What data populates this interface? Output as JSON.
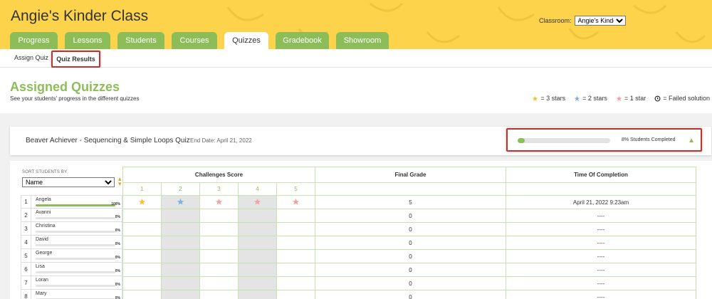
{
  "header": {
    "title": "Angie's Kinder Class",
    "classroom_label": "Classroom:",
    "classroom_value": "Angie's Kinde..."
  },
  "tabs": [
    {
      "label": "Progress",
      "active": false
    },
    {
      "label": "Lessons",
      "active": false
    },
    {
      "label": "Students",
      "active": false
    },
    {
      "label": "Courses",
      "active": false
    },
    {
      "label": "Quizzes",
      "active": true
    },
    {
      "label": "Gradebook",
      "active": false
    },
    {
      "label": "Showroom",
      "active": false
    }
  ],
  "subnav": {
    "assign": "Assign Quiz",
    "results": "Quiz Results"
  },
  "page": {
    "title": "Assigned Quizzes",
    "subtitle": "See your students' progress in the different quizzes"
  },
  "legend": {
    "three_stars": "= 3 stars",
    "two_stars": "= 2 stars",
    "one_star": "= 1 star",
    "failed": "= Failed solution"
  },
  "quiz": {
    "name": "Beaver Achiever - Sequencing & Simple Loops Quiz",
    "end_date": "End Date:  April 21, 2022",
    "progress_text": "8% Students Completed",
    "progress_fraction": 0.08
  },
  "sort": {
    "label": "SORT STUDENTS BY",
    "value": "Name"
  },
  "table": {
    "challenges_header": "Challenges Score",
    "final_header": "Final Grade",
    "time_header": "Time Of Completion",
    "challenge_numbers": [
      "1",
      "2",
      "3",
      "4",
      "5"
    ]
  },
  "colors": {
    "gold": "#f6c338",
    "blue": "#7ab5dc",
    "pink": "#f3a2a2",
    "accent": "#8dbd58"
  },
  "students": [
    {
      "idx": "1",
      "name": "Angela",
      "pct": "100%",
      "fill": 1.0,
      "stars": [
        "gold",
        "blue",
        "pink",
        "pink",
        "pink"
      ],
      "grade": "5",
      "time": "April 21, 2022 9:23am"
    },
    {
      "idx": "2",
      "name": "Avanni",
      "pct": "0%",
      "fill": 0,
      "stars": [],
      "grade": "0",
      "time": "----"
    },
    {
      "idx": "3",
      "name": "Christina",
      "pct": "0%",
      "fill": 0,
      "stars": [],
      "grade": "0",
      "time": "----"
    },
    {
      "idx": "4",
      "name": "David",
      "pct": "0%",
      "fill": 0,
      "stars": [],
      "grade": "0",
      "time": "----"
    },
    {
      "idx": "5",
      "name": "George",
      "pct": "0%",
      "fill": 0,
      "stars": [],
      "grade": "0",
      "time": "----"
    },
    {
      "idx": "6",
      "name": "Lisa",
      "pct": "0%",
      "fill": 0,
      "stars": [],
      "grade": "0",
      "time": "----"
    },
    {
      "idx": "7",
      "name": "Loran",
      "pct": "0%",
      "fill": 0,
      "stars": [],
      "grade": "0",
      "time": "----"
    },
    {
      "idx": "8",
      "name": "Mary",
      "pct": "0%",
      "fill": 0,
      "stars": [],
      "grade": "0",
      "time": "----"
    }
  ]
}
